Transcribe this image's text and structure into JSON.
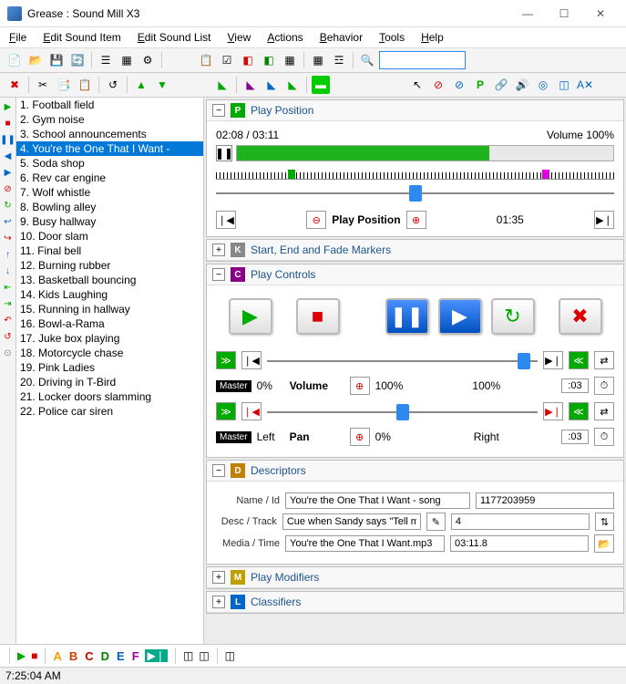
{
  "window": {
    "title": "Grease : Sound Mill X3"
  },
  "menu": [
    "File",
    "Edit Sound Item",
    "Edit Sound List",
    "View",
    "Actions",
    "Behavior",
    "Tools",
    "Help"
  ],
  "soundlist": {
    "items": [
      "1. Football field",
      "2. Gym noise",
      "3. School announcements",
      "4. You're the One That I Want -",
      "5. Soda shop",
      "6. Rev car engine",
      "7. Wolf whistle",
      "8. Bowling alley",
      "9. Busy hallway",
      "10. Door slam",
      "11. Final bell",
      "12. Burning rubber",
      "13. Basketball bouncing",
      "14. Kids Laughing",
      "15. Running in hallway",
      "16. Bowl-a-Rama",
      "17. Juke box playing",
      "18. Motorcycle chase",
      "19. Pink Ladies",
      "20. Driving in T-Bird",
      "21. Locker doors slamming",
      "22. Police car siren"
    ],
    "selected": 3
  },
  "playPosition": {
    "title": "Play Position",
    "time": "02:08 / 03:11",
    "volumeLabel": "Volume  100%",
    "label": "Play Position",
    "value": "01:35",
    "progressPct": 67
  },
  "markers": {
    "title": "Start, End and Fade Markers"
  },
  "controls": {
    "title": "Play Controls",
    "masterLabel": "Master",
    "volLabel": "Volume",
    "panLabel": "Pan",
    "zeroPct": "0%",
    "hundred": "100%",
    "hundred2": "100%",
    "left": "Left",
    "right": "Right",
    "panVal": "0%",
    "t03a": ":03",
    "t03b": ":03"
  },
  "descriptors": {
    "title": "Descriptors",
    "nameLabel": "Name / Id",
    "name": "You're the One That I Want - song",
    "id": "1177203959",
    "descLabel": "Desc / Track",
    "desc": "Cue when Sandy says \"Tell me about it, stud.\"",
    "track": "4",
    "mediaLabel": "Media / Time",
    "media": "You're the One That I Want.mp3",
    "time": "03:11.8"
  },
  "modifiers": {
    "title": "Play Modifiers"
  },
  "classifiers": {
    "title": "Classifiers"
  },
  "bottom": {
    "letters": [
      {
        "t": "A",
        "c": "#f0a000"
      },
      {
        "t": "B",
        "c": "#d04000"
      },
      {
        "t": "C",
        "c": "#c00000"
      },
      {
        "t": "D",
        "c": "#008000"
      },
      {
        "t": "E",
        "c": "#0060c0"
      },
      {
        "t": "F",
        "c": "#a000a0"
      }
    ]
  },
  "status": {
    "time": "7:25:04 AM"
  }
}
